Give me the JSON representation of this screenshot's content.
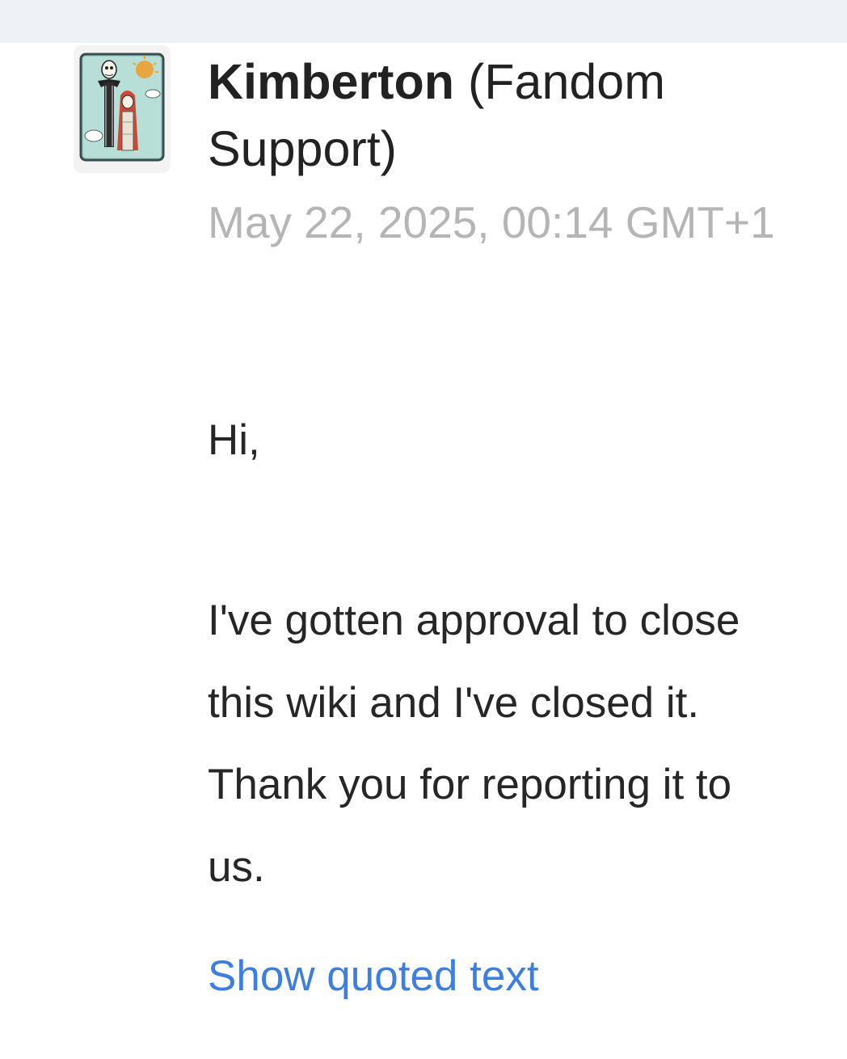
{
  "message": {
    "sender": {
      "name": "Kimberton",
      "affiliation": "(Fandom Support)",
      "avatar_icon": "avatar-image"
    },
    "timestamp": "May 22, 2025, 00:14 GMT+1",
    "greeting": "Hi,",
    "body": "I've gotten approval to close this wiki and I've closed it. Thank you for reporting it to us.",
    "show_quoted_label": "Show quoted text"
  },
  "colors": {
    "top_bar": "#eef1f6",
    "text": "#262626",
    "timestamp": "#b5b5b5",
    "link": "#3d7fe0"
  }
}
